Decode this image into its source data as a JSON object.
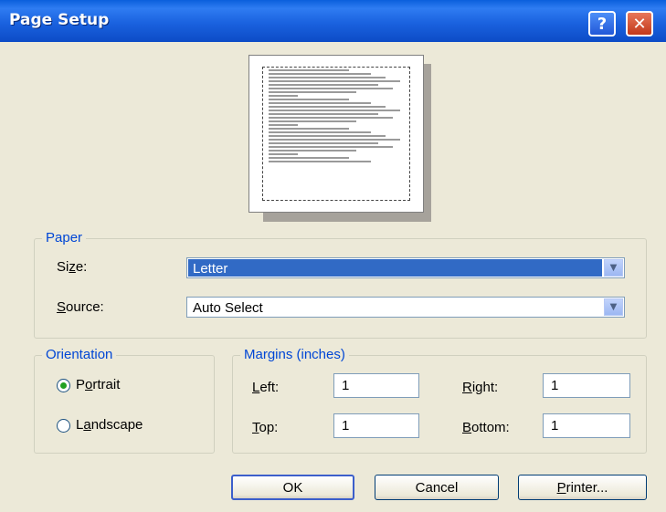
{
  "window": {
    "title": "Page Setup",
    "help_glyph": "?",
    "close_glyph": "✕"
  },
  "paper": {
    "legend": "Paper",
    "size_label_prefix": "Si",
    "size_label_mnemonic": "z",
    "size_label_suffix": "e:",
    "size_value": "Letter",
    "source_mnemonic": "S",
    "source_label_suffix": "ource:",
    "source_value": "Auto Select"
  },
  "orientation": {
    "legend": "Orientation",
    "portrait_prefix": "P",
    "portrait_mnemonic": "o",
    "portrait_suffix": "rtrait",
    "landscape_prefix": "L",
    "landscape_mnemonic": "a",
    "landscape_suffix": "ndscape",
    "selected": "portrait"
  },
  "margins": {
    "legend": "Margins (inches)",
    "left_mnemonic": "L",
    "left_suffix": "eft:",
    "left_value": "1",
    "right_mnemonic": "R",
    "right_suffix": "ight:",
    "right_value": "1",
    "top_mnemonic": "T",
    "top_suffix": "op:",
    "top_value": "1",
    "bottom_mnemonic": "B",
    "bottom_suffix": "ottom:",
    "bottom_value": "1"
  },
  "buttons": {
    "ok": "OK",
    "cancel": "Cancel",
    "printer_mnemonic": "P",
    "printer_suffix": "rinter..."
  },
  "colors": {
    "titlebar": "#0a5fdc",
    "legend_text": "#0046d5",
    "selection": "#316ac5",
    "dialog_bg": "#ece9d8"
  },
  "icons": {
    "help": "help-icon",
    "close": "close-icon",
    "dropdown": "chevron-down-icon"
  }
}
